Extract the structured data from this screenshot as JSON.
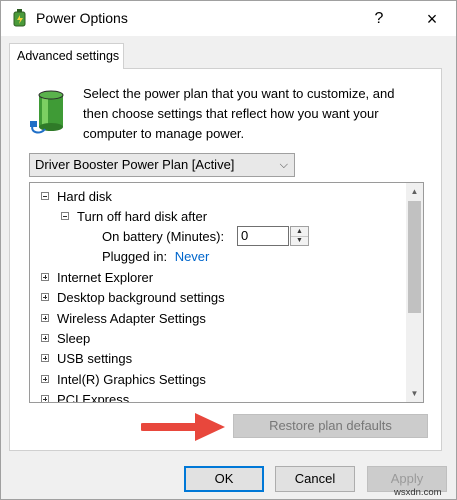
{
  "window": {
    "title": "Power Options",
    "help": "?",
    "close": "×"
  },
  "tab": {
    "label": "Advanced settings"
  },
  "description": "Select the power plan that you want to customize, and then choose settings that reflect how you want your computer to manage power.",
  "plan_select": {
    "value": "Driver Booster Power Plan [Active]"
  },
  "tree": {
    "hard_disk": "Hard disk",
    "turn_off": "Turn off hard disk after",
    "on_battery_label": "On battery (Minutes):",
    "on_battery_value": "0",
    "plugged_in_label": "Plugged in:",
    "plugged_in_value": "Never",
    "items": [
      "Internet Explorer",
      "Desktop background settings",
      "Wireless Adapter Settings",
      "Sleep",
      "USB settings",
      "Intel(R) Graphics Settings",
      "PCI Express"
    ]
  },
  "restore_button": "Restore plan defaults",
  "buttons": {
    "ok": "OK",
    "cancel": "Cancel",
    "apply": "Apply"
  },
  "watermark": "wsxdn.com",
  "colors": {
    "link": "#0066cc",
    "focus_border": "#0078d7",
    "arrow": "#e8473c"
  }
}
